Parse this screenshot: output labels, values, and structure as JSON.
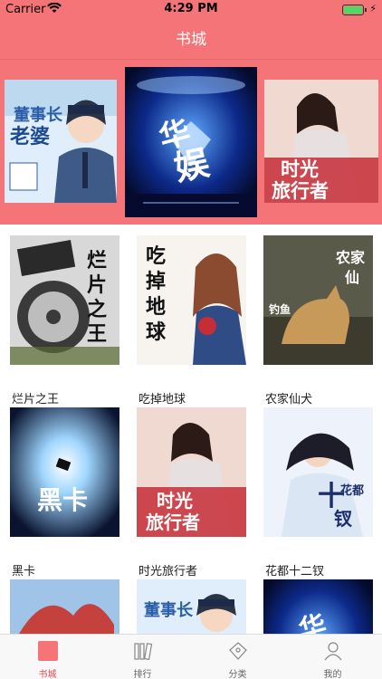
{
  "status_bar": {
    "carrier": "Carrier",
    "time": "4:29 PM"
  },
  "nav": {
    "title": "书城"
  },
  "colors": {
    "theme_red": "#f47478",
    "active_tab": "#e94b51"
  },
  "banner": {
    "covers": [
      {
        "cover_art_text": "我的董事长老婆"
      },
      {
        "cover_art_text": "华娱"
      },
      {
        "cover_art_text": "时光旅行者"
      }
    ]
  },
  "books": [
    {
      "title": "烂片之王",
      "cover_art_text": "烂片之王"
    },
    {
      "title": "吃掉地球",
      "cover_art_text": "吃掉地球"
    },
    {
      "title": "农家仙犬",
      "cover_art_text": "农家仙犬"
    },
    {
      "title": "黑卡",
      "cover_art_text": "黑卡"
    },
    {
      "title": "时光旅行者",
      "cover_art_text": "时光旅行者"
    },
    {
      "title": "花都十二钗",
      "cover_art_text": "花都十二钗"
    },
    {
      "title": "",
      "cover_art_text": ""
    },
    {
      "title": "",
      "cover_art_text": "我的董事长老婆"
    },
    {
      "title": "",
      "cover_art_text": "华娱"
    }
  ],
  "tabbar": {
    "tabs": [
      {
        "label": "书城",
        "icon": "bookstore-icon",
        "active": true
      },
      {
        "label": "排行",
        "icon": "ranking-icon",
        "active": false
      },
      {
        "label": "分类",
        "icon": "category-icon",
        "active": false
      },
      {
        "label": "我的",
        "icon": "profile-icon",
        "active": false
      }
    ]
  }
}
